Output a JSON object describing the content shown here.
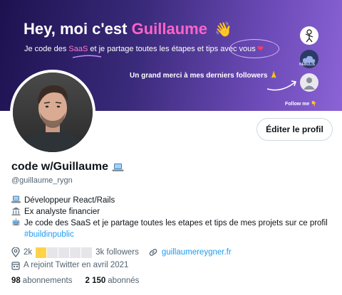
{
  "banner": {
    "headline_prefix": "Hey, moi c'est",
    "headline_name": "Guillaume",
    "headline_emoji": "👋",
    "sub_part1": "Je code des",
    "sub_saas": "SaaS",
    "sub_part2": "et je partage toutes les étapes et tips avec",
    "sub_vous": "vous",
    "sub_heart": "❤",
    "thanks": "Un grand merci à mes derniers followers 🙏",
    "nebulis": "NEBULIS",
    "follow_me": "Follow me 👇"
  },
  "profile": {
    "edit_button": "Éditer le profil",
    "display_name": "code w/Guillaume",
    "handle": "@guillaume_rygn",
    "bio": {
      "line1": "Développeur React/Rails",
      "line2": "Ex analyste financier",
      "line3": "Je code des SaaS et je partage toutes les etapes et tips de mes projets sur ce profil",
      "hashtag": "#buildinpublic"
    },
    "location_prefix": "2k",
    "location_suffix": "3k followers",
    "website": "guillaumereygner.fr",
    "joined": "A rejoint Twitter en avril 2021",
    "following_count": "98",
    "following_label": "abonnements",
    "followers_count": "2 150",
    "followers_label": "abonnés"
  },
  "colors": {
    "accent": "#1d9bf0",
    "name_pink": "#ff63c8",
    "progress_gold": "#ffd24a"
  },
  "icons": {
    "laptop": "laptop-icon",
    "bank": "bank-icon",
    "robot": "robot-icon",
    "location": "location-icon",
    "link": "link-icon",
    "calendar": "calendar-icon"
  },
  "progress": {
    "filled": 1,
    "total": 5
  }
}
